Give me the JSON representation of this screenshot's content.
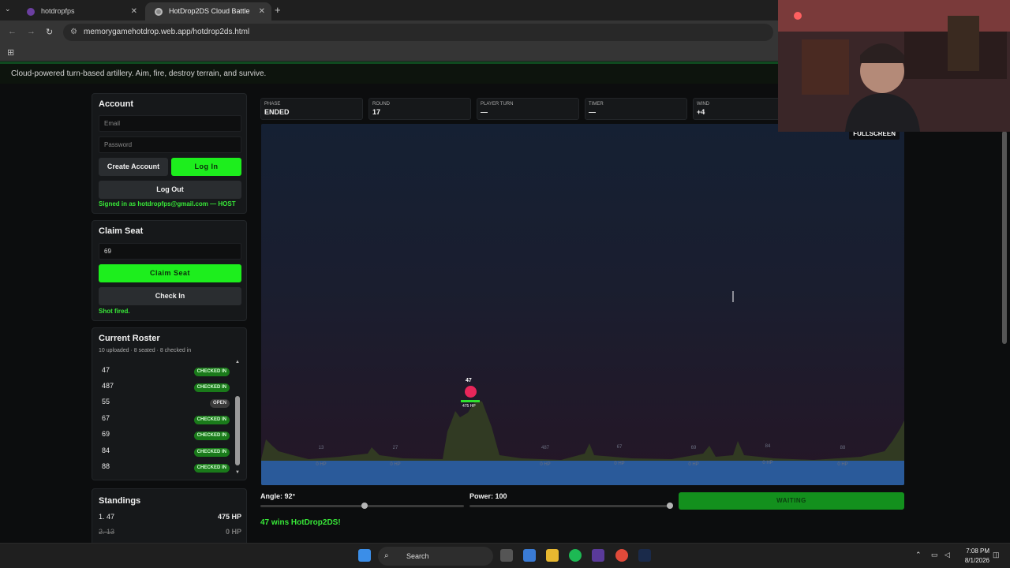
{
  "browser": {
    "tabs": [
      {
        "title": "hotdropfps"
      },
      {
        "title": "HotDrop2DS Cloud Battle"
      }
    ],
    "url": "memorygamehotdrop.web.app/hotdrop2ds.html"
  },
  "header": {
    "tagline": "Cloud-powered turn-based artillery. Aim, fire, destroy terrain, and survive."
  },
  "account": {
    "title": "Account",
    "email_placeholder": "Email",
    "password_placeholder": "Password",
    "create_label": "Create Account",
    "login_label": "Log In",
    "logout_label": "Log Out",
    "status": "Signed in as hotdropfps@gmail.com — HOST"
  },
  "claim_seat": {
    "title": "Claim Seat",
    "seat_value": "69",
    "claim_label": "Claim Seat",
    "checkin_label": "Check In",
    "status": "Shot fired."
  },
  "roster": {
    "title": "Current Roster",
    "summary": "10 uploaded · 8 seated · 8 checked in",
    "rows": [
      {
        "seat": "47",
        "status": "CHECKED IN"
      },
      {
        "seat": "487",
        "status": "CHECKED IN"
      },
      {
        "seat": "55",
        "status": "OPEN"
      },
      {
        "seat": "67",
        "status": "CHECKED IN"
      },
      {
        "seat": "69",
        "status": "CHECKED IN"
      },
      {
        "seat": "84",
        "status": "CHECKED IN"
      },
      {
        "seat": "88",
        "status": "CHECKED IN"
      }
    ]
  },
  "standings": {
    "title": "Standings",
    "rows": [
      {
        "name": "1. 47",
        "hp": "475 HP"
      },
      {
        "name": "2. 13",
        "hp": "0 HP"
      }
    ]
  },
  "stats": [
    {
      "label": "PHASE",
      "value": "ENDED"
    },
    {
      "label": "ROUND",
      "value": "17"
    },
    {
      "label": "PLAYER TURN",
      "value": "—"
    },
    {
      "label": "TIMER",
      "value": "—"
    },
    {
      "label": "WIND",
      "value": "+4"
    }
  ],
  "arena": {
    "fullscreen_label": "FULLSCREEN",
    "active_tank": {
      "name": "47",
      "hp_label": "475 HP"
    },
    "dead_tanks": [
      {
        "name": "13",
        "hp": "0 HP"
      },
      {
        "name": "27",
        "hp": "0 HP"
      },
      {
        "name": "487",
        "hp": "0 HP"
      },
      {
        "name": "67",
        "hp": "0 HP"
      },
      {
        "name": "69",
        "hp": "0 HP"
      },
      {
        "name": "84",
        "hp": "0 HP"
      },
      {
        "name": "88",
        "hp": "0 HP"
      }
    ]
  },
  "controls": {
    "angle_label": "Angle: 92°",
    "angle_value": 92,
    "angle_max": 180,
    "power_label": "Power: 100",
    "power_value": 100,
    "power_max": 100,
    "action_label": "WAITING",
    "result": "47 wins HotDrop2DS!"
  },
  "taskbar": {
    "search_label": "Search",
    "time": "7:08 PM",
    "date": "8/1/2026"
  },
  "colors": {
    "accent_green": "#1dee1d",
    "tank_red": "#e8265a",
    "water": "#2a5a9a"
  }
}
